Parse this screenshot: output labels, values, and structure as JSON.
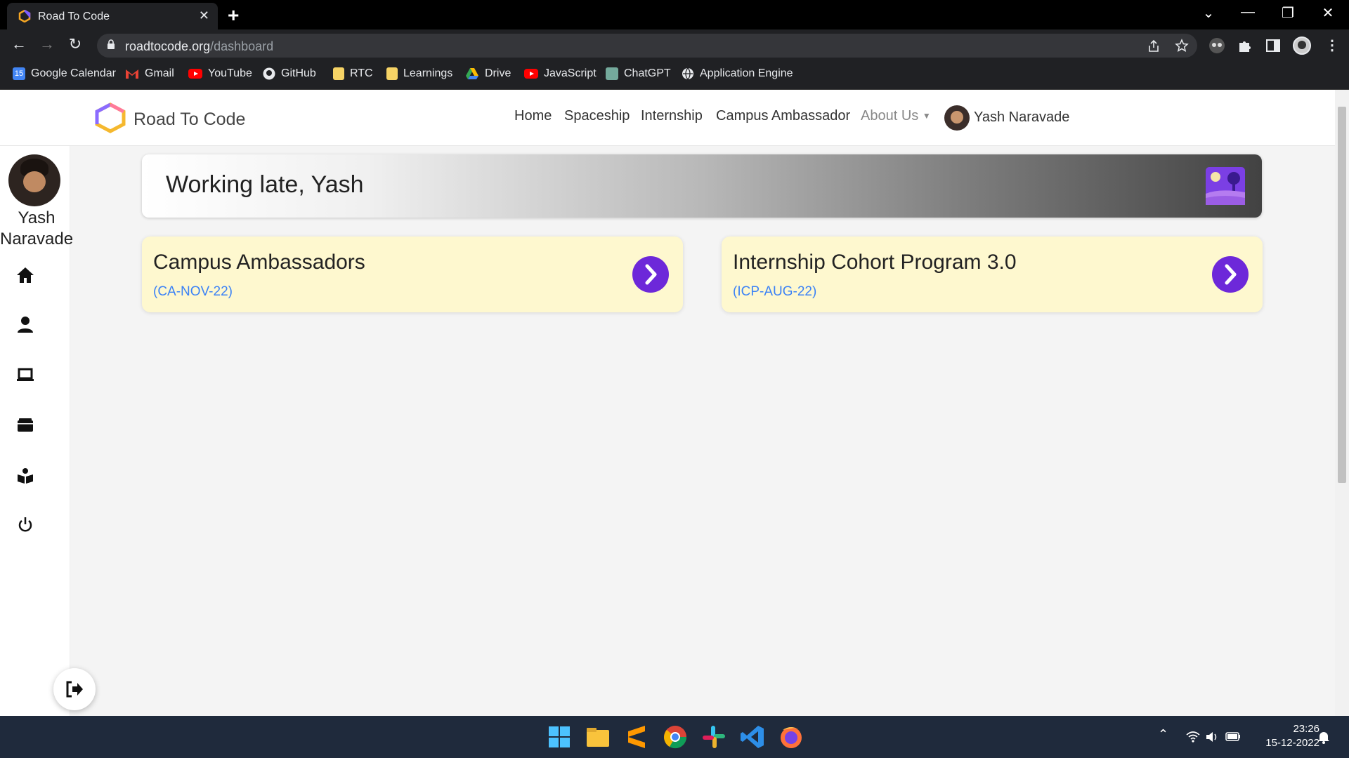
{
  "browser": {
    "tab_title": "Road To Code",
    "tab_close": "✕",
    "new_tab": "+",
    "url_host": "roadtocode.org",
    "url_path": "/dashboard",
    "window_controls": {
      "minimize": "—",
      "restore": "❐",
      "close": "✕",
      "dropdown": "⌄"
    },
    "nav": {
      "back": "←",
      "forward": "→",
      "reload": "↻"
    }
  },
  "bookmarks": [
    {
      "label": "Google Calendar",
      "icon": "calendar-icon",
      "color": "#4285f4"
    },
    {
      "label": "Gmail",
      "icon": "gmail-icon",
      "color": "#ea4335"
    },
    {
      "label": "YouTube",
      "icon": "youtube-icon",
      "color": "#ff0000"
    },
    {
      "label": "GitHub",
      "icon": "github-icon",
      "color": "#ffffff"
    },
    {
      "label": "RTC",
      "icon": "folder-icon",
      "color": "#f6d365"
    },
    {
      "label": "Learnings",
      "icon": "folder-icon",
      "color": "#f6d365"
    },
    {
      "label": "Drive",
      "icon": "drive-icon",
      "color": "#34a853"
    },
    {
      "label": "JavaScript",
      "icon": "youtube-icon",
      "color": "#ff0000"
    },
    {
      "label": "ChatGPT",
      "icon": "chatgpt-icon",
      "color": "#74aa9c"
    },
    {
      "label": "Application Engine",
      "icon": "globe-icon",
      "color": "#ffffff"
    }
  ],
  "header": {
    "site_name": "Road To Code",
    "nav": [
      "Home",
      "Spaceship",
      "Internship",
      "Campus Ambassador",
      "About Us"
    ],
    "user_name": "Yash Naravade"
  },
  "sidebar": {
    "user_first": "Yash",
    "user_last": "Naravade",
    "items": [
      "home-icon",
      "user-icon",
      "laptop-icon",
      "wallet-icon",
      "reader-icon",
      "power-icon"
    ]
  },
  "main": {
    "greeting": "Working late, Yash",
    "cards": [
      {
        "title": "Campus Ambassadors",
        "code": "(CA-NOV-22)"
      },
      {
        "title": "Internship Cohort Program 3.0",
        "code": "(ICP-AUG-22)"
      }
    ]
  },
  "taskbar": {
    "time": "23:26",
    "date": "15-12-2022"
  },
  "colors": {
    "accent": "#6d28d9",
    "card_bg": "#fef8cf",
    "code_link": "#3b82f6"
  }
}
